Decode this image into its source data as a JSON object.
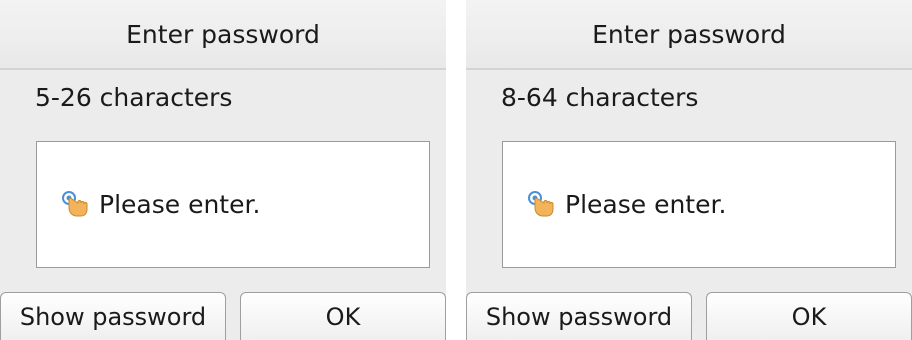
{
  "panels": [
    {
      "title": "Enter password",
      "subtitle": "5-26 characters",
      "entry_placeholder": "Please enter.",
      "entry_icon": "touch-hand-icon",
      "buttons": {
        "show_password": "Show password",
        "ok": "OK"
      }
    },
    {
      "title": "Enter password",
      "subtitle": "8-64 characters",
      "entry_placeholder": "Please enter.",
      "entry_icon": "touch-hand-icon",
      "buttons": {
        "show_password": "Show password",
        "ok": "OK"
      }
    }
  ],
  "colors": {
    "panel_bg": "#ececec",
    "entry_bg": "#ffffff",
    "icon_hand": "#f2b35a",
    "icon_ripple": "#4a90d9"
  }
}
